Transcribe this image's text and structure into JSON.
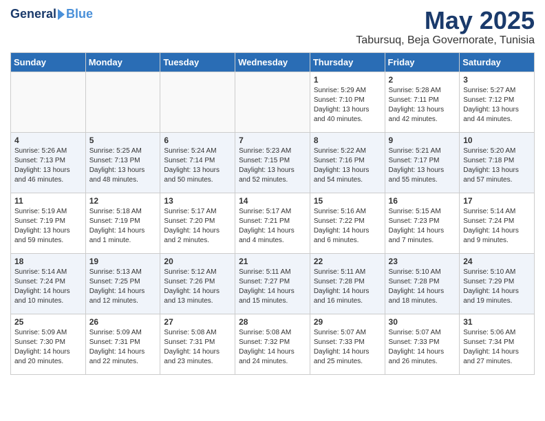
{
  "logo": {
    "general": "General",
    "blue": "Blue"
  },
  "title": "May 2025",
  "location": "Tabursuq, Beja Governorate, Tunisia",
  "days_of_week": [
    "Sunday",
    "Monday",
    "Tuesday",
    "Wednesday",
    "Thursday",
    "Friday",
    "Saturday"
  ],
  "weeks": [
    [
      {
        "day": "",
        "sunrise": "",
        "sunset": "",
        "daylight": ""
      },
      {
        "day": "",
        "sunrise": "",
        "sunset": "",
        "daylight": ""
      },
      {
        "day": "",
        "sunrise": "",
        "sunset": "",
        "daylight": ""
      },
      {
        "day": "",
        "sunrise": "",
        "sunset": "",
        "daylight": ""
      },
      {
        "day": "1",
        "sunrise": "Sunrise: 5:29 AM",
        "sunset": "Sunset: 7:10 PM",
        "daylight": "Daylight: 13 hours and 40 minutes."
      },
      {
        "day": "2",
        "sunrise": "Sunrise: 5:28 AM",
        "sunset": "Sunset: 7:11 PM",
        "daylight": "Daylight: 13 hours and 42 minutes."
      },
      {
        "day": "3",
        "sunrise": "Sunrise: 5:27 AM",
        "sunset": "Sunset: 7:12 PM",
        "daylight": "Daylight: 13 hours and 44 minutes."
      }
    ],
    [
      {
        "day": "4",
        "sunrise": "Sunrise: 5:26 AM",
        "sunset": "Sunset: 7:13 PM",
        "daylight": "Daylight: 13 hours and 46 minutes."
      },
      {
        "day": "5",
        "sunrise": "Sunrise: 5:25 AM",
        "sunset": "Sunset: 7:13 PM",
        "daylight": "Daylight: 13 hours and 48 minutes."
      },
      {
        "day": "6",
        "sunrise": "Sunrise: 5:24 AM",
        "sunset": "Sunset: 7:14 PM",
        "daylight": "Daylight: 13 hours and 50 minutes."
      },
      {
        "day": "7",
        "sunrise": "Sunrise: 5:23 AM",
        "sunset": "Sunset: 7:15 PM",
        "daylight": "Daylight: 13 hours and 52 minutes."
      },
      {
        "day": "8",
        "sunrise": "Sunrise: 5:22 AM",
        "sunset": "Sunset: 7:16 PM",
        "daylight": "Daylight: 13 hours and 54 minutes."
      },
      {
        "day": "9",
        "sunrise": "Sunrise: 5:21 AM",
        "sunset": "Sunset: 7:17 PM",
        "daylight": "Daylight: 13 hours and 55 minutes."
      },
      {
        "day": "10",
        "sunrise": "Sunrise: 5:20 AM",
        "sunset": "Sunset: 7:18 PM",
        "daylight": "Daylight: 13 hours and 57 minutes."
      }
    ],
    [
      {
        "day": "11",
        "sunrise": "Sunrise: 5:19 AM",
        "sunset": "Sunset: 7:19 PM",
        "daylight": "Daylight: 13 hours and 59 minutes."
      },
      {
        "day": "12",
        "sunrise": "Sunrise: 5:18 AM",
        "sunset": "Sunset: 7:19 PM",
        "daylight": "Daylight: 14 hours and 1 minute."
      },
      {
        "day": "13",
        "sunrise": "Sunrise: 5:17 AM",
        "sunset": "Sunset: 7:20 PM",
        "daylight": "Daylight: 14 hours and 2 minutes."
      },
      {
        "day": "14",
        "sunrise": "Sunrise: 5:17 AM",
        "sunset": "Sunset: 7:21 PM",
        "daylight": "Daylight: 14 hours and 4 minutes."
      },
      {
        "day": "15",
        "sunrise": "Sunrise: 5:16 AM",
        "sunset": "Sunset: 7:22 PM",
        "daylight": "Daylight: 14 hours and 6 minutes."
      },
      {
        "day": "16",
        "sunrise": "Sunrise: 5:15 AM",
        "sunset": "Sunset: 7:23 PM",
        "daylight": "Daylight: 14 hours and 7 minutes."
      },
      {
        "day": "17",
        "sunrise": "Sunrise: 5:14 AM",
        "sunset": "Sunset: 7:24 PM",
        "daylight": "Daylight: 14 hours and 9 minutes."
      }
    ],
    [
      {
        "day": "18",
        "sunrise": "Sunrise: 5:14 AM",
        "sunset": "Sunset: 7:24 PM",
        "daylight": "Daylight: 14 hours and 10 minutes."
      },
      {
        "day": "19",
        "sunrise": "Sunrise: 5:13 AM",
        "sunset": "Sunset: 7:25 PM",
        "daylight": "Daylight: 14 hours and 12 minutes."
      },
      {
        "day": "20",
        "sunrise": "Sunrise: 5:12 AM",
        "sunset": "Sunset: 7:26 PM",
        "daylight": "Daylight: 14 hours and 13 minutes."
      },
      {
        "day": "21",
        "sunrise": "Sunrise: 5:11 AM",
        "sunset": "Sunset: 7:27 PM",
        "daylight": "Daylight: 14 hours and 15 minutes."
      },
      {
        "day": "22",
        "sunrise": "Sunrise: 5:11 AM",
        "sunset": "Sunset: 7:28 PM",
        "daylight": "Daylight: 14 hours and 16 minutes."
      },
      {
        "day": "23",
        "sunrise": "Sunrise: 5:10 AM",
        "sunset": "Sunset: 7:28 PM",
        "daylight": "Daylight: 14 hours and 18 minutes."
      },
      {
        "day": "24",
        "sunrise": "Sunrise: 5:10 AM",
        "sunset": "Sunset: 7:29 PM",
        "daylight": "Daylight: 14 hours and 19 minutes."
      }
    ],
    [
      {
        "day": "25",
        "sunrise": "Sunrise: 5:09 AM",
        "sunset": "Sunset: 7:30 PM",
        "daylight": "Daylight: 14 hours and 20 minutes."
      },
      {
        "day": "26",
        "sunrise": "Sunrise: 5:09 AM",
        "sunset": "Sunset: 7:31 PM",
        "daylight": "Daylight: 14 hours and 22 minutes."
      },
      {
        "day": "27",
        "sunrise": "Sunrise: 5:08 AM",
        "sunset": "Sunset: 7:31 PM",
        "daylight": "Daylight: 14 hours and 23 minutes."
      },
      {
        "day": "28",
        "sunrise": "Sunrise: 5:08 AM",
        "sunset": "Sunset: 7:32 PM",
        "daylight": "Daylight: 14 hours and 24 minutes."
      },
      {
        "day": "29",
        "sunrise": "Sunrise: 5:07 AM",
        "sunset": "Sunset: 7:33 PM",
        "daylight": "Daylight: 14 hours and 25 minutes."
      },
      {
        "day": "30",
        "sunrise": "Sunrise: 5:07 AM",
        "sunset": "Sunset: 7:33 PM",
        "daylight": "Daylight: 14 hours and 26 minutes."
      },
      {
        "day": "31",
        "sunrise": "Sunrise: 5:06 AM",
        "sunset": "Sunset: 7:34 PM",
        "daylight": "Daylight: 14 hours and 27 minutes."
      }
    ]
  ]
}
